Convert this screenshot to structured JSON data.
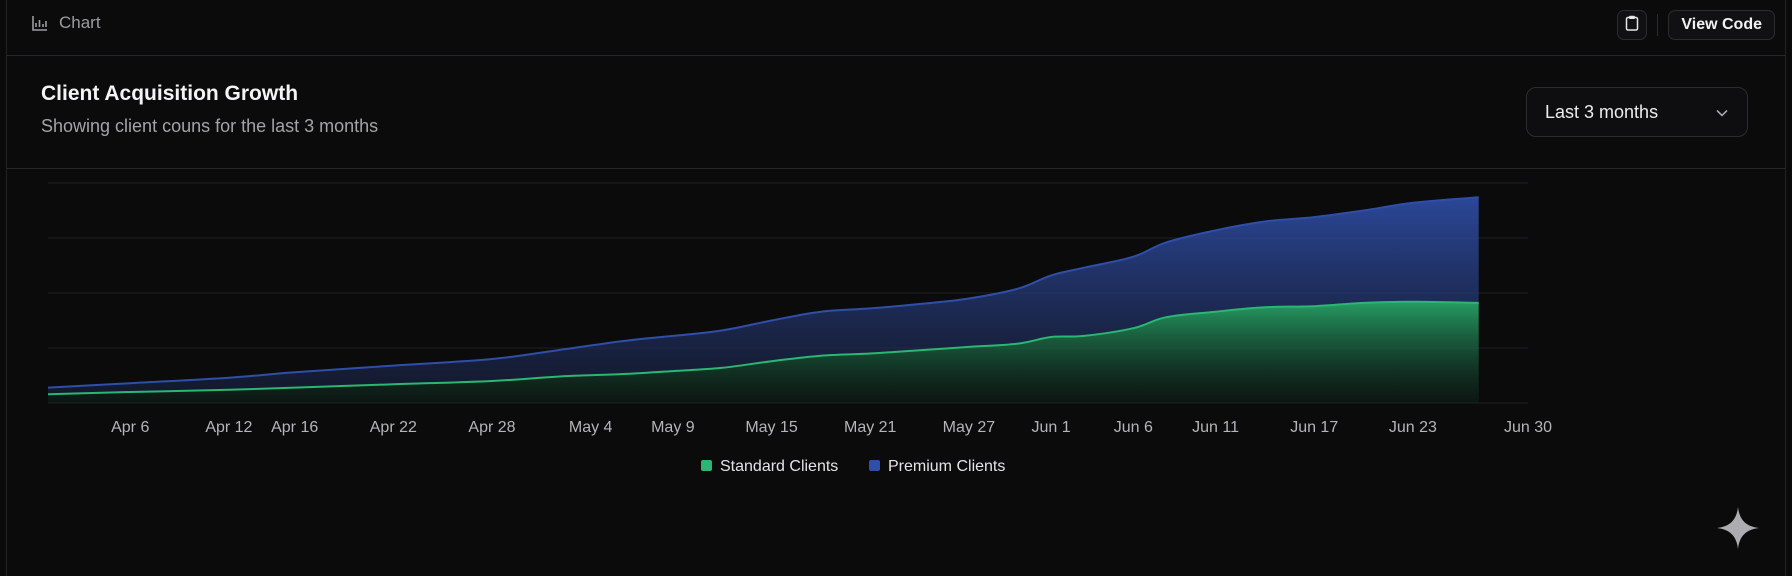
{
  "toolbar": {
    "chart_label": "Chart",
    "chart_icon": "chart-icon",
    "clipboard_icon": "clipboard-icon",
    "view_code_label": "View Code"
  },
  "header": {
    "title": "Client Acquisition Growth",
    "subtitle": "Showing client couns for the last 3 months",
    "range_select": {
      "value": "Last 3 months",
      "icon": "chevron-down-icon"
    }
  },
  "colors": {
    "standard": "#2bb673",
    "premium": "#2f4ea8",
    "grid": "#1f1f23",
    "tick_text": "#b4b4ba"
  },
  "chart_data": {
    "type": "area",
    "stacked": true,
    "title": "Client Acquisition Growth",
    "subtitle": "Showing client couns for the last 3 months",
    "x_tick_labels": [
      "Apr 6",
      "Apr 12",
      "Apr 16",
      "Apr 22",
      "Apr 28",
      "May 4",
      "May 9",
      "May 15",
      "May 21",
      "May 27",
      "Jun 1",
      "Jun 6",
      "Jun 11",
      "Jun 17",
      "Jun 23",
      "Jun 30"
    ],
    "x": [
      "Apr 1",
      "Apr 6",
      "Apr 12",
      "Apr 16",
      "Apr 22",
      "Apr 28",
      "May 2",
      "May 6",
      "May 9",
      "May 12",
      "May 15",
      "May 18",
      "May 21",
      "May 24",
      "May 27",
      "May 30",
      "Jun 1",
      "Jun 3",
      "Jun 6",
      "Jun 8",
      "Jun 11",
      "Jun 14",
      "Jun 17",
      "Jun 20",
      "Jun 23",
      "Jun 27"
    ],
    "series": [
      {
        "name": "Standard Clients",
        "values": [
          4,
          5,
          6,
          7,
          8.5,
          10,
          12,
          13.2,
          14.5,
          16,
          19,
          21.5,
          22.5,
          24,
          25.5,
          27,
          30,
          30.5,
          34,
          39,
          41.5,
          43.5,
          44,
          45.5,
          46,
          45.5
        ]
      },
      {
        "name": "Premium Clients",
        "values": [
          3,
          4,
          5.5,
          7,
          8.5,
          10,
          12,
          15,
          16,
          17,
          18.5,
          20,
          20.5,
          21,
          22,
          25,
          28,
          31,
          32.5,
          34,
          37,
          39,
          40.5,
          42,
          45,
          48
        ]
      }
    ],
    "ylim": [
      0,
      100
    ],
    "grid": true,
    "legend_position": "bottom-center"
  }
}
